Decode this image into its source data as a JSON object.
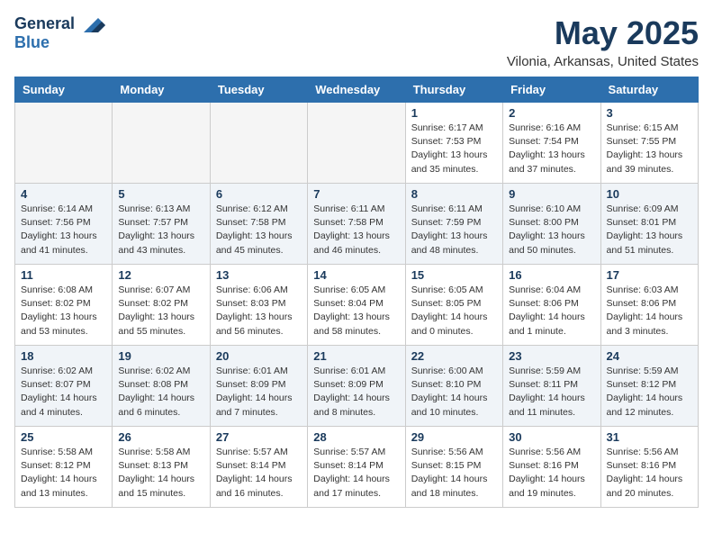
{
  "logo": {
    "general": "General",
    "blue": "Blue"
  },
  "title": "May 2025",
  "location": "Vilonia, Arkansas, United States",
  "days_of_week": [
    "Sunday",
    "Monday",
    "Tuesday",
    "Wednesday",
    "Thursday",
    "Friday",
    "Saturday"
  ],
  "weeks": [
    [
      {
        "day": "",
        "info": ""
      },
      {
        "day": "",
        "info": ""
      },
      {
        "day": "",
        "info": ""
      },
      {
        "day": "",
        "info": ""
      },
      {
        "day": "1",
        "info": "Sunrise: 6:17 AM\nSunset: 7:53 PM\nDaylight: 13 hours\nand 35 minutes."
      },
      {
        "day": "2",
        "info": "Sunrise: 6:16 AM\nSunset: 7:54 PM\nDaylight: 13 hours\nand 37 minutes."
      },
      {
        "day": "3",
        "info": "Sunrise: 6:15 AM\nSunset: 7:55 PM\nDaylight: 13 hours\nand 39 minutes."
      }
    ],
    [
      {
        "day": "4",
        "info": "Sunrise: 6:14 AM\nSunset: 7:56 PM\nDaylight: 13 hours\nand 41 minutes."
      },
      {
        "day": "5",
        "info": "Sunrise: 6:13 AM\nSunset: 7:57 PM\nDaylight: 13 hours\nand 43 minutes."
      },
      {
        "day": "6",
        "info": "Sunrise: 6:12 AM\nSunset: 7:58 PM\nDaylight: 13 hours\nand 45 minutes."
      },
      {
        "day": "7",
        "info": "Sunrise: 6:11 AM\nSunset: 7:58 PM\nDaylight: 13 hours\nand 46 minutes."
      },
      {
        "day": "8",
        "info": "Sunrise: 6:11 AM\nSunset: 7:59 PM\nDaylight: 13 hours\nand 48 minutes."
      },
      {
        "day": "9",
        "info": "Sunrise: 6:10 AM\nSunset: 8:00 PM\nDaylight: 13 hours\nand 50 minutes."
      },
      {
        "day": "10",
        "info": "Sunrise: 6:09 AM\nSunset: 8:01 PM\nDaylight: 13 hours\nand 51 minutes."
      }
    ],
    [
      {
        "day": "11",
        "info": "Sunrise: 6:08 AM\nSunset: 8:02 PM\nDaylight: 13 hours\nand 53 minutes."
      },
      {
        "day": "12",
        "info": "Sunrise: 6:07 AM\nSunset: 8:02 PM\nDaylight: 13 hours\nand 55 minutes."
      },
      {
        "day": "13",
        "info": "Sunrise: 6:06 AM\nSunset: 8:03 PM\nDaylight: 13 hours\nand 56 minutes."
      },
      {
        "day": "14",
        "info": "Sunrise: 6:05 AM\nSunset: 8:04 PM\nDaylight: 13 hours\nand 58 minutes."
      },
      {
        "day": "15",
        "info": "Sunrise: 6:05 AM\nSunset: 8:05 PM\nDaylight: 14 hours\nand 0 minutes."
      },
      {
        "day": "16",
        "info": "Sunrise: 6:04 AM\nSunset: 8:06 PM\nDaylight: 14 hours\nand 1 minute."
      },
      {
        "day": "17",
        "info": "Sunrise: 6:03 AM\nSunset: 8:06 PM\nDaylight: 14 hours\nand 3 minutes."
      }
    ],
    [
      {
        "day": "18",
        "info": "Sunrise: 6:02 AM\nSunset: 8:07 PM\nDaylight: 14 hours\nand 4 minutes."
      },
      {
        "day": "19",
        "info": "Sunrise: 6:02 AM\nSunset: 8:08 PM\nDaylight: 14 hours\nand 6 minutes."
      },
      {
        "day": "20",
        "info": "Sunrise: 6:01 AM\nSunset: 8:09 PM\nDaylight: 14 hours\nand 7 minutes."
      },
      {
        "day": "21",
        "info": "Sunrise: 6:01 AM\nSunset: 8:09 PM\nDaylight: 14 hours\nand 8 minutes."
      },
      {
        "day": "22",
        "info": "Sunrise: 6:00 AM\nSunset: 8:10 PM\nDaylight: 14 hours\nand 10 minutes."
      },
      {
        "day": "23",
        "info": "Sunrise: 5:59 AM\nSunset: 8:11 PM\nDaylight: 14 hours\nand 11 minutes."
      },
      {
        "day": "24",
        "info": "Sunrise: 5:59 AM\nSunset: 8:12 PM\nDaylight: 14 hours\nand 12 minutes."
      }
    ],
    [
      {
        "day": "25",
        "info": "Sunrise: 5:58 AM\nSunset: 8:12 PM\nDaylight: 14 hours\nand 13 minutes."
      },
      {
        "day": "26",
        "info": "Sunrise: 5:58 AM\nSunset: 8:13 PM\nDaylight: 14 hours\nand 15 minutes."
      },
      {
        "day": "27",
        "info": "Sunrise: 5:57 AM\nSunset: 8:14 PM\nDaylight: 14 hours\nand 16 minutes."
      },
      {
        "day": "28",
        "info": "Sunrise: 5:57 AM\nSunset: 8:14 PM\nDaylight: 14 hours\nand 17 minutes."
      },
      {
        "day": "29",
        "info": "Sunrise: 5:56 AM\nSunset: 8:15 PM\nDaylight: 14 hours\nand 18 minutes."
      },
      {
        "day": "30",
        "info": "Sunrise: 5:56 AM\nSunset: 8:16 PM\nDaylight: 14 hours\nand 19 minutes."
      },
      {
        "day": "31",
        "info": "Sunrise: 5:56 AM\nSunset: 8:16 PM\nDaylight: 14 hours\nand 20 minutes."
      }
    ]
  ]
}
